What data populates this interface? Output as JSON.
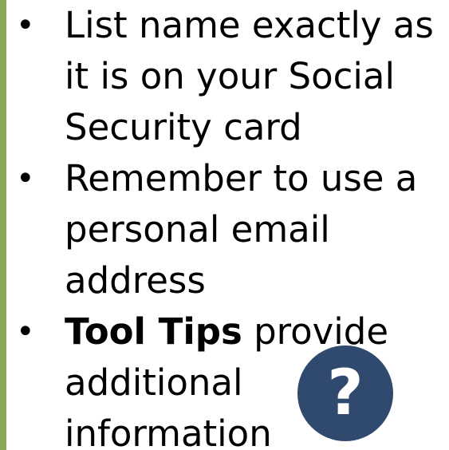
{
  "colors": {
    "accent_bar": "#8aa65a",
    "tooltip_icon_bg": "#2f4a6e",
    "text": "#000000"
  },
  "bullets": {
    "bullet_symbol": "•",
    "item1": {
      "line1": "List name exactly as",
      "line2": "it is on your Social",
      "line3": "Security card"
    },
    "item2": {
      "line1": "Remember to use a",
      "line2": "personal email",
      "line3": "address"
    },
    "item3": {
      "bold": "Tool Tips",
      "line1_rest": " provide",
      "line2": "additional",
      "line3": "information"
    }
  },
  "tooltip_icon": {
    "glyph": "?",
    "icon_name": "question-mark-icon"
  }
}
